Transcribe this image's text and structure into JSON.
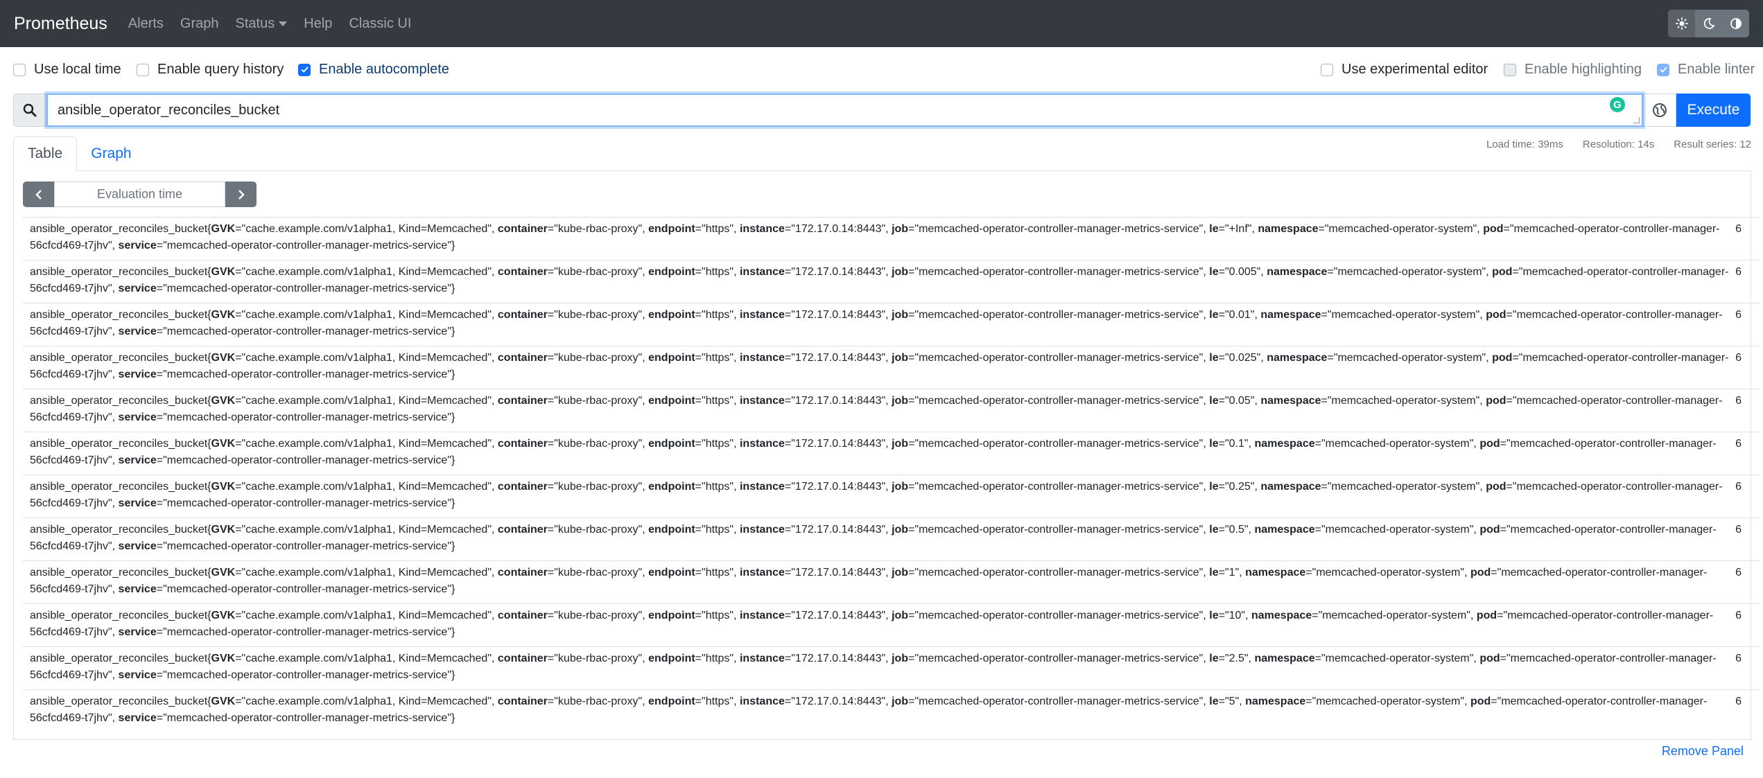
{
  "navbar": {
    "brand": "Prometheus",
    "items": [
      "Alerts",
      "Graph",
      "Status",
      "Help",
      "Classic UI"
    ],
    "theme_icons": [
      "sun-icon",
      "moon-icon",
      "contrast-icon"
    ]
  },
  "options": {
    "use_local_time": "Use local time",
    "enable_query_history": "Enable query history",
    "enable_autocomplete": "Enable autocomplete",
    "use_experimental_editor": "Use experimental editor",
    "enable_highlighting": "Enable highlighting",
    "enable_linter": "Enable linter"
  },
  "query": {
    "value": "ansible_operator_reconciles_bucket",
    "execute_label": "Execute"
  },
  "tabs": {
    "table": "Table",
    "graph": "Graph"
  },
  "stats": {
    "load_time": "Load time: 39ms",
    "resolution": "Resolution: 14s",
    "result_series": "Result series: 12"
  },
  "eval": {
    "placeholder": "Evaluation time"
  },
  "series_rows": [
    {
      "le": "+Inf",
      "value": "6"
    },
    {
      "le": "0.005",
      "value": "6"
    },
    {
      "le": "0.01",
      "value": "6"
    },
    {
      "le": "0.025",
      "value": "6"
    },
    {
      "le": "0.05",
      "value": "6"
    },
    {
      "le": "0.1",
      "value": "6"
    },
    {
      "le": "0.25",
      "value": "6"
    },
    {
      "le": "0.5",
      "value": "6"
    },
    {
      "le": "1",
      "value": "6"
    },
    {
      "le": "10",
      "value": "6"
    },
    {
      "le": "2.5",
      "value": "6"
    },
    {
      "le": "5",
      "value": "6"
    }
  ],
  "series_common": {
    "metric": "ansible_operator_reconciles_bucket",
    "GVK": "cache.example.com/v1alpha1, Kind=Memcached",
    "container": "kube-rbac-proxy",
    "endpoint": "https",
    "instance": "172.17.0.14:8443",
    "job": "memcached-operator-controller-manager-metrics-service",
    "namespace": "memcached-operator-system",
    "pod": "memcached-operator-controller-manager-56cfcd469-t7jhv",
    "service": "memcached-operator-controller-manager-metrics-service"
  },
  "remove_panel": "Remove Panel"
}
